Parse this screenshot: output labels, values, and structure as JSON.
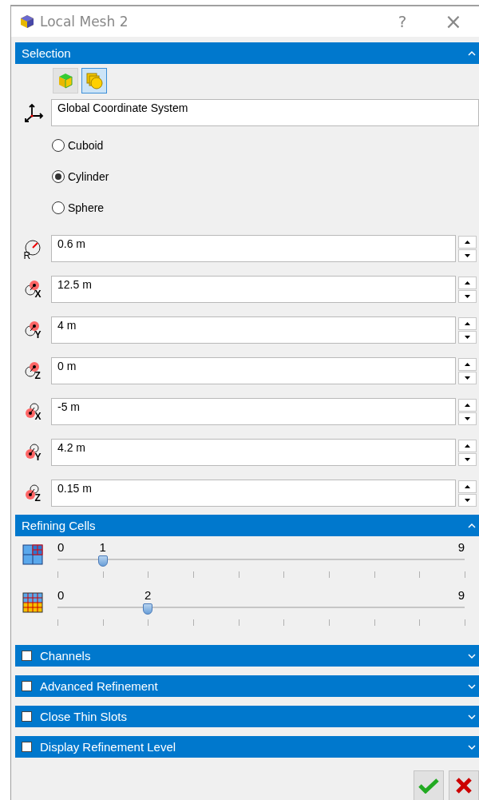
{
  "window": {
    "title": "Local Mesh 2",
    "help": "?",
    "close": "×"
  },
  "selection": {
    "title": "Selection",
    "expanded": true,
    "modes": [
      {
        "kind": "box",
        "selected": false
      },
      {
        "kind": "shapes",
        "selected": true
      }
    ],
    "coordinate_system": "Global Coordinate System",
    "shapes": [
      {
        "label": "Cuboid",
        "selected": false
      },
      {
        "label": "Cylinder",
        "selected": true
      },
      {
        "label": "Sphere",
        "selected": false
      }
    ],
    "fields": [
      {
        "kind": "radius",
        "icon_label": "R",
        "value": "0.6 m"
      },
      {
        "kind": "center",
        "icon_label": "X",
        "value": "12.5 m"
      },
      {
        "kind": "center",
        "icon_label": "Y",
        "value": "4 m"
      },
      {
        "kind": "center",
        "icon_label": "Z",
        "value": "0 m"
      },
      {
        "kind": "end",
        "icon_label": "X",
        "value": "-5 m"
      },
      {
        "kind": "end",
        "icon_label": "Y",
        "value": "4.2 m"
      },
      {
        "kind": "end",
        "icon_label": "Z",
        "value": "0.15 m"
      }
    ]
  },
  "refining_cells": {
    "title": "Refining Cells",
    "expanded": true,
    "sliders": [
      {
        "kind": "cells",
        "min": "0",
        "max": "9",
        "value": "1",
        "level": 0.111
      },
      {
        "kind": "grid",
        "min": "0",
        "max": "9",
        "value": "2",
        "level": 0.222
      }
    ]
  },
  "sections": [
    {
      "title": "Channels",
      "checked": false,
      "expanded": false
    },
    {
      "title": "Advanced Refinement",
      "checked": false,
      "expanded": false
    },
    {
      "title": "Close Thin Slots",
      "checked": false,
      "expanded": false
    },
    {
      "title": "Display Refinement Level",
      "checked": false,
      "expanded": false
    }
  ],
  "buttons": [
    {
      "kind": "ok"
    },
    {
      "kind": "cancel"
    }
  ]
}
